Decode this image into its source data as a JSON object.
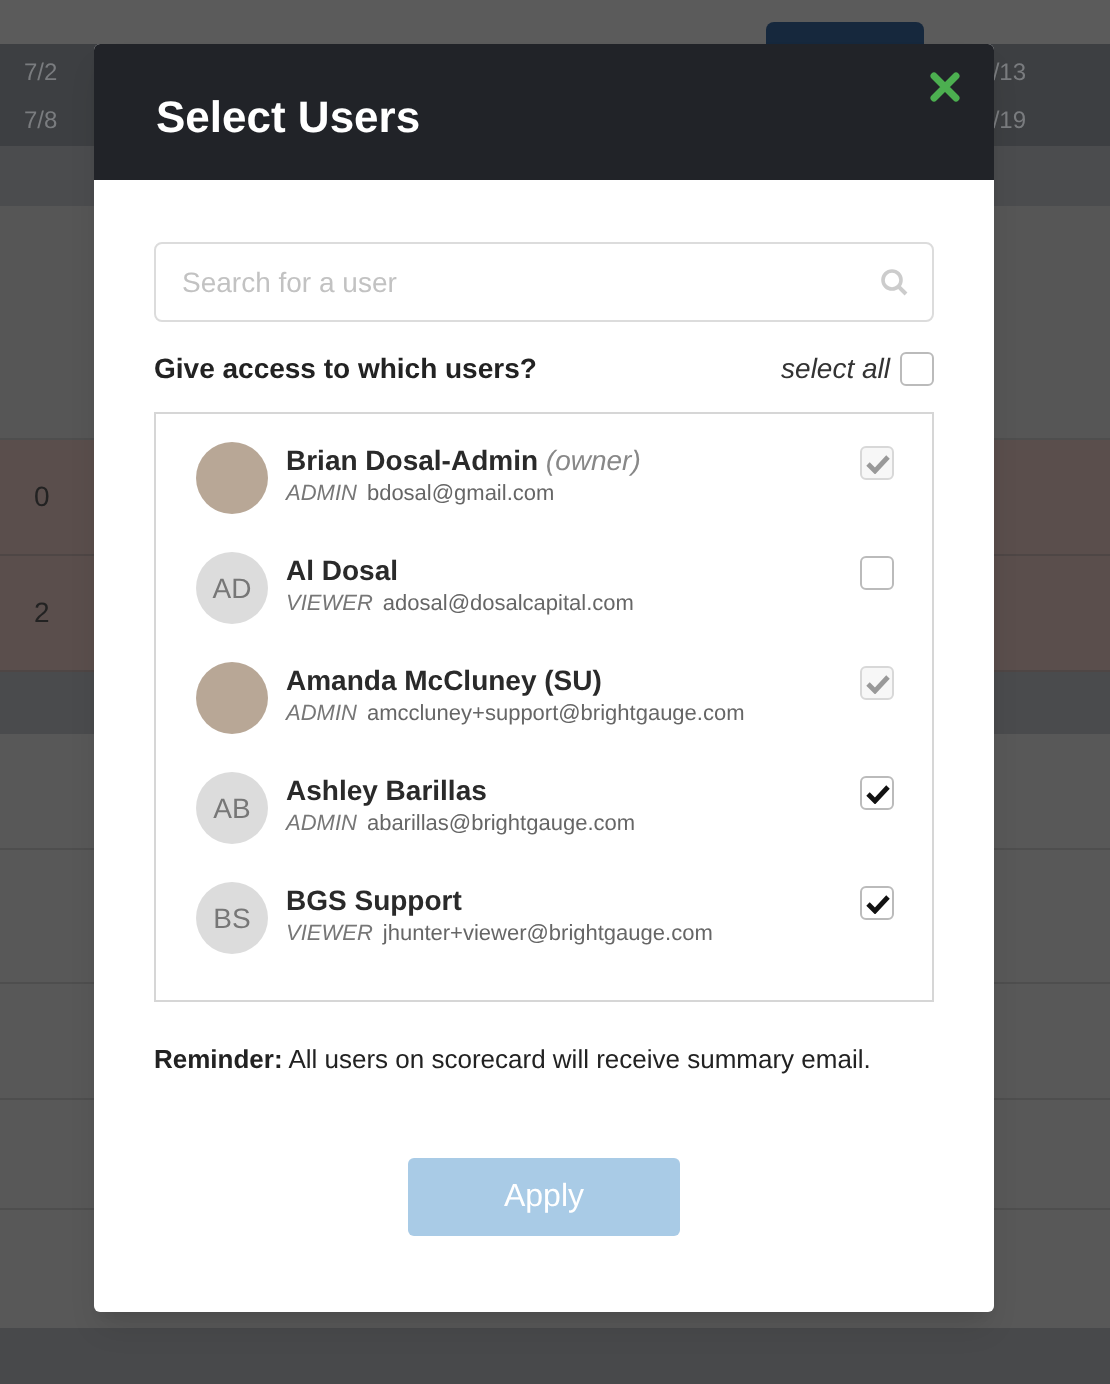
{
  "background": {
    "dates_left": [
      "7/2",
      "7/8"
    ],
    "dates_right": [
      "/13",
      "/19"
    ],
    "cells": [
      "0",
      "2"
    ]
  },
  "modal": {
    "title": "Select Users",
    "search": {
      "placeholder": "Search for a user"
    },
    "prompt": "Give access to which users?",
    "select_all": {
      "label": "select all",
      "checked": false
    },
    "users": [
      {
        "name": "Brian Dosal-Admin",
        "note": "(owner)",
        "role": "ADMIN",
        "email": "bdosal@gmail.com",
        "kind": "photo",
        "checked": true,
        "disabled": true
      },
      {
        "name": "Al Dosal",
        "role": "VIEWER",
        "email": "adosal@dosalcapital.com",
        "kind": "initials",
        "initials": "AD",
        "checked": false,
        "disabled": false
      },
      {
        "name": "Amanda McCluney (SU)",
        "role": "ADMIN",
        "email": "amccluney+support@brightgauge.com",
        "kind": "photo",
        "checked": true,
        "disabled": true
      },
      {
        "name": "Ashley Barillas",
        "role": "ADMIN",
        "email": "abarillas@brightgauge.com",
        "kind": "initials",
        "initials": "AB",
        "checked": true,
        "disabled": false
      },
      {
        "name": "BGS Support",
        "role": "VIEWER",
        "email": "jhunter+viewer@brightgauge.com",
        "kind": "initials",
        "initials": "BS",
        "checked": true,
        "disabled": false
      }
    ],
    "reminder": "**Reminder:** All users on scorecard will receive summary email.",
    "apply_button": {
      "label": "Apply",
      "disabled": true
    }
  }
}
